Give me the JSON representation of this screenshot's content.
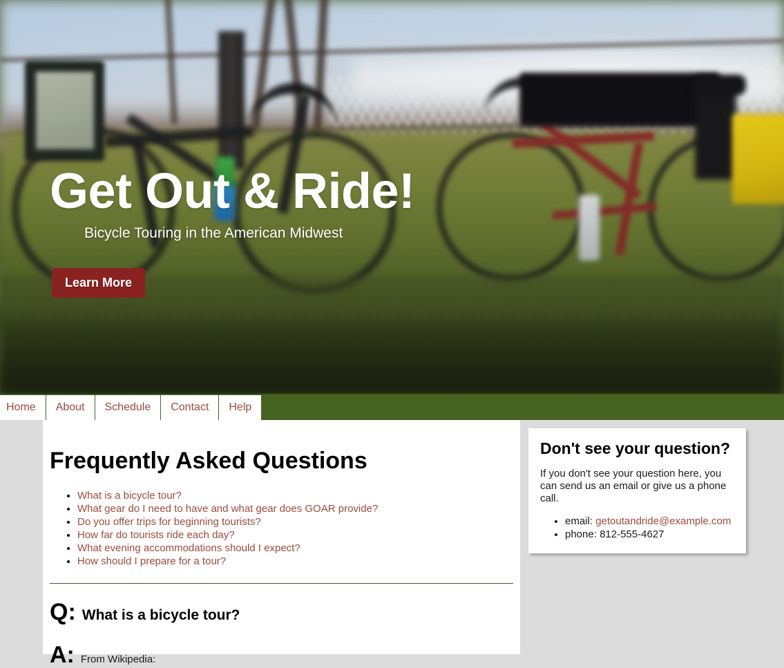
{
  "hero": {
    "title": "Get Out & Ride!",
    "subtitle": "Bicycle Touring in the American Midwest",
    "cta_label": "Learn More",
    "cta_color": "#8a2222",
    "image_description": "blurred photo of two touring bicycles leaning on a fence in a grassy field"
  },
  "nav": {
    "background_color": "#466321",
    "link_color": "#9c4a3c",
    "items": [
      {
        "label": "Home"
      },
      {
        "label": "About"
      },
      {
        "label": "Schedule"
      },
      {
        "label": "Contact"
      },
      {
        "label": "Help"
      }
    ]
  },
  "main": {
    "heading": "Frequently Asked Questions",
    "faq_links": [
      {
        "label": "What is a bicycle tour?"
      },
      {
        "label": "What gear do I need to have and what gear does GOAR provide?"
      },
      {
        "label": "Do you offer trips for beginning tourists?"
      },
      {
        "label": "How far do tourists ride each day?"
      },
      {
        "label": "What evening accommodations should I expect?"
      },
      {
        "label": "How should I prepare for a tour?"
      }
    ],
    "qa": {
      "q_marker": "Q:",
      "question": "What is a bicycle tour?",
      "a_marker": "A:",
      "answer_intro": "From Wikipedia:"
    }
  },
  "sidebar": {
    "heading": "Don't see your question?",
    "body": "If you don't see your question here, you can send us an email or give us a phone call.",
    "contacts": [
      {
        "label": "email:",
        "value": "getoutandride@example.com",
        "is_link": true
      },
      {
        "label": "phone:",
        "value": "812-555-4627",
        "is_link": false
      }
    ]
  },
  "colors": {
    "page_background": "#dcdcdc",
    "card_background": "#ffffff",
    "accent_green": "#466321",
    "link_brown": "#9c4a3c"
  }
}
